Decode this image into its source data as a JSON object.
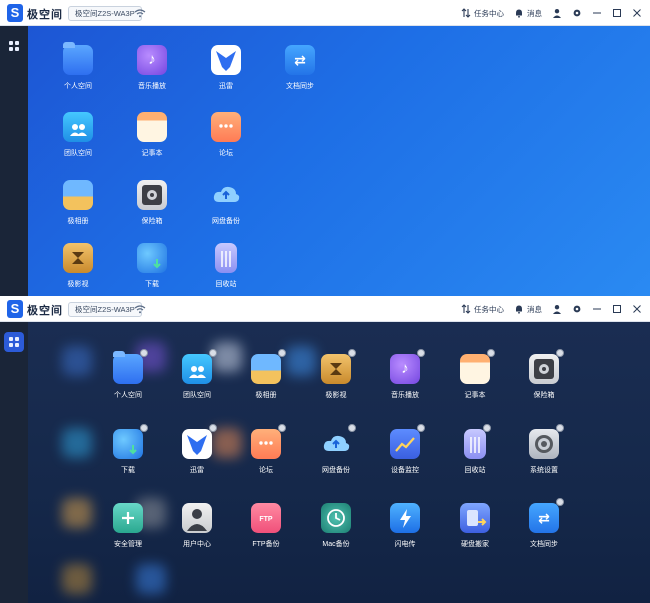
{
  "titlebar": {
    "logo_letter": "S",
    "brand": "极空间",
    "device": "极空间Z2S-WA3P",
    "tasks_label": "任务中心",
    "messages_label": "消息"
  },
  "top_apps": [
    {
      "label": "个人空间"
    },
    {
      "label": "音乐播放"
    },
    {
      "label": "迅雷"
    },
    {
      "label": "文档同步"
    },
    {
      "label": "团队空间"
    },
    {
      "label": "记事本"
    },
    {
      "label": "论坛"
    },
    {
      "label": "极相册"
    },
    {
      "label": "保险箱"
    },
    {
      "label": "网盘备份"
    },
    {
      "label": "极影视"
    },
    {
      "label": "下载"
    },
    {
      "label": "回收站"
    }
  ],
  "bottom_apps": [
    {
      "label": "个人空间"
    },
    {
      "label": "团队空间"
    },
    {
      "label": "极相册"
    },
    {
      "label": "极影视"
    },
    {
      "label": "音乐播放"
    },
    {
      "label": "记事本"
    },
    {
      "label": "保险箱"
    },
    {
      "label": "下载"
    },
    {
      "label": "迅雷"
    },
    {
      "label": "论坛"
    },
    {
      "label": "网盘备份"
    },
    {
      "label": "设备监控"
    },
    {
      "label": "回收站"
    },
    {
      "label": "系统设置"
    },
    {
      "label": "安全管理"
    },
    {
      "label": "用户中心"
    },
    {
      "label": "FTP备份"
    },
    {
      "label": "Mac备份"
    },
    {
      "label": "闪电传"
    },
    {
      "label": "硬盘搬家"
    },
    {
      "label": "文档同步"
    }
  ],
  "colors": {
    "accent": "#1f64e8",
    "desktop_light": "#1e6fe6",
    "desktop_dark": "#15284a"
  }
}
